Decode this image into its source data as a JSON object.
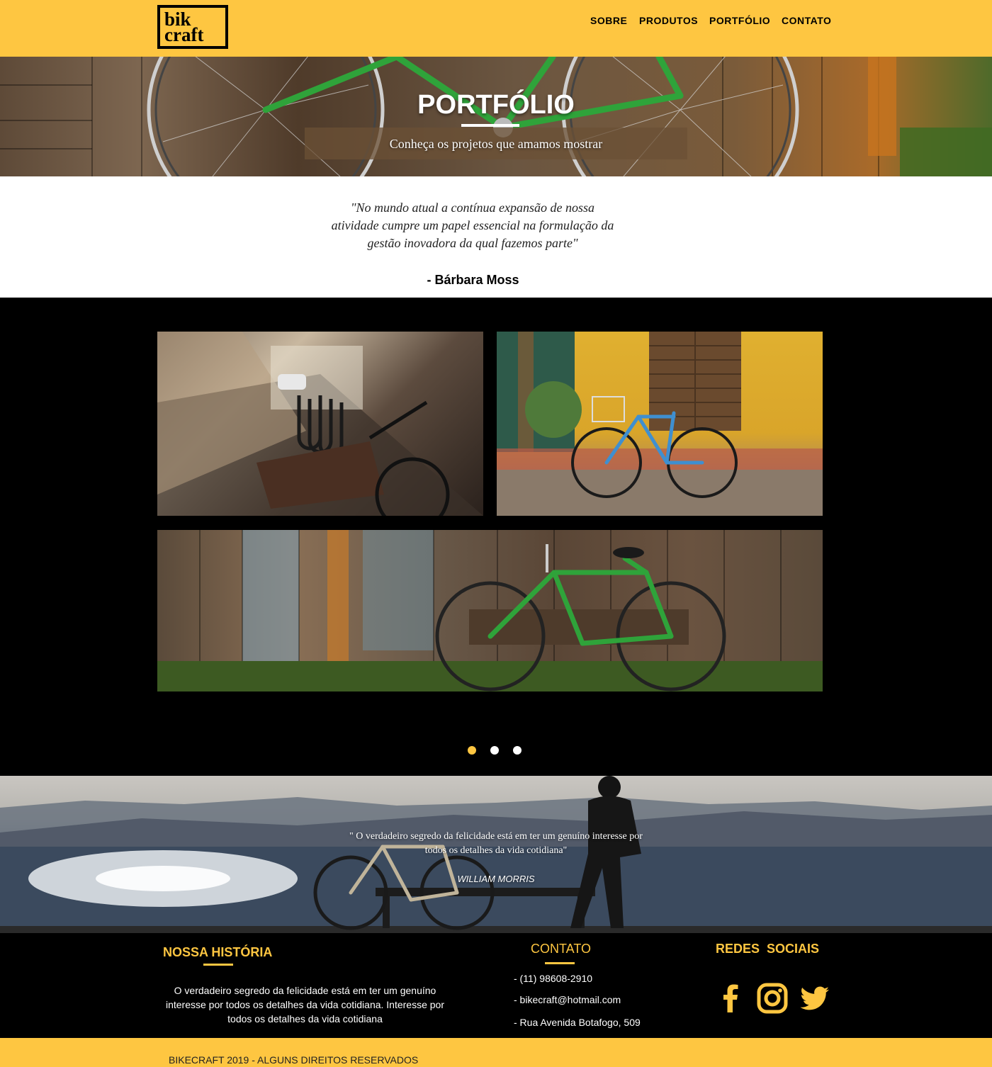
{
  "brand": {
    "logo_line1": "bik",
    "logo_line2": "craft"
  },
  "nav": {
    "items": [
      "SOBRE",
      "PRODUTOS",
      "PORTFÓLIO",
      "CONTATO"
    ]
  },
  "hero": {
    "title": "PORTFÓLIO",
    "subtitle": "Conheça os projetos que amamos mostrar"
  },
  "quote": {
    "text": "\"No mundo atual a contínua expansão de nossa atividade cumpre um papel essencial na formulação da gestão inovadora da qual fazemos parte\"",
    "author": "- Bárbara Moss"
  },
  "gallery": {
    "photos": [
      "city-street-bikes-photo",
      "yellow-wall-blue-bike-photo",
      "green-bike-wooden-fence-photo"
    ],
    "slides_total": 3,
    "active_slide": 1
  },
  "band": {
    "quote": "\" O verdadeiro segredo da felicidade está em ter um genuíno interesse por todos os detalhes da vida cotidiana\"",
    "author": "WILLIAM MORRIS"
  },
  "footer": {
    "history": {
      "title": "NOSSA HISTÓRIA",
      "text": "O verdadeiro segredo da felicidade está em ter um genuíno interesse por todos os detalhes da vida cotidiana. Interesse por todos os detalhes da vida cotidiana"
    },
    "contact": {
      "title": "CONTATO",
      "phone": "- (11) 98608-2910",
      "email": "- bikecraft@hotmail.com",
      "address": "- Rua Avenida Botafogo, 509"
    },
    "social": {
      "title": "REDES  SOCIAIS",
      "icons": [
        "facebook-icon",
        "instagram-icon",
        "twitter-icon"
      ]
    },
    "copyright": "BIKECRAFT 2019 - ALGUNS DIREITOS RESERVADOS"
  },
  "colors": {
    "accent": "#FEC641",
    "dark": "#000000",
    "light": "#ffffff"
  }
}
